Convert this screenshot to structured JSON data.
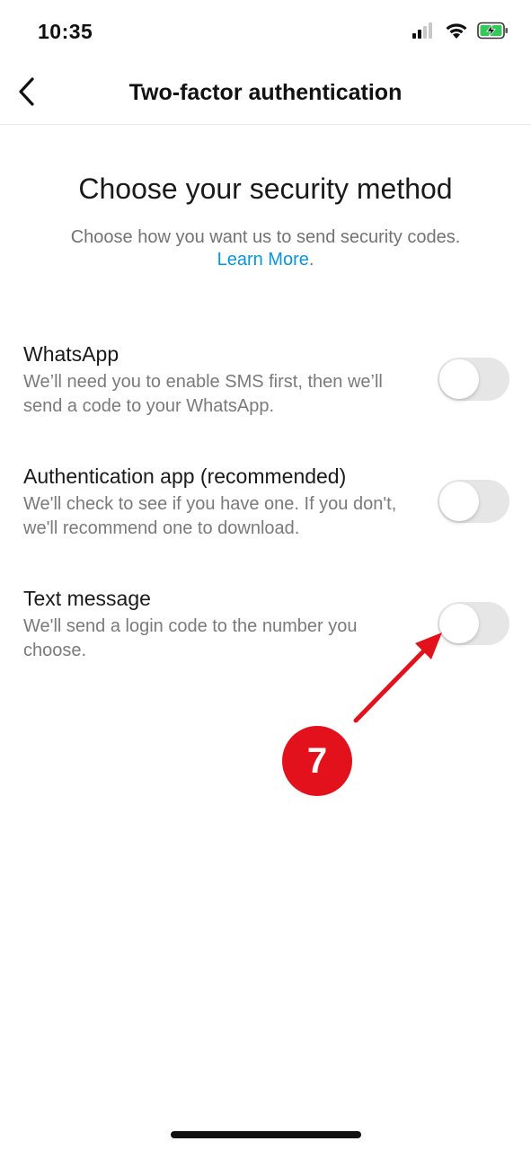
{
  "status_bar": {
    "time": "10:35",
    "icons": [
      "cellular-signal-icon",
      "wifi-icon",
      "battery-charging-icon"
    ]
  },
  "nav": {
    "back_icon": "chevron-left-icon",
    "title": "Two-factor authentication"
  },
  "main": {
    "heading": "Choose your security method",
    "subheading": "Choose how you want us to send security codes.",
    "learn_more": "Learn More",
    "learn_more_suffix": "."
  },
  "options": [
    {
      "title": "WhatsApp",
      "description": "We’ll need you to enable SMS first, then we’ll send a code to your WhatsApp.",
      "enabled": false
    },
    {
      "title": "Authentication app (recommended)",
      "description": "We'll check to see if you have one. If you don't, we'll recommend one to download.",
      "enabled": false
    },
    {
      "title": "Text message",
      "description": "We'll send a login code to the number you choose.",
      "enabled": false
    }
  ],
  "annotation": {
    "step_number": "7",
    "color": "#e3111c"
  },
  "colors": {
    "link": "#0a95d8",
    "toggle_off": "#e6e6e6",
    "secondary_text": "#7a7a7a"
  }
}
